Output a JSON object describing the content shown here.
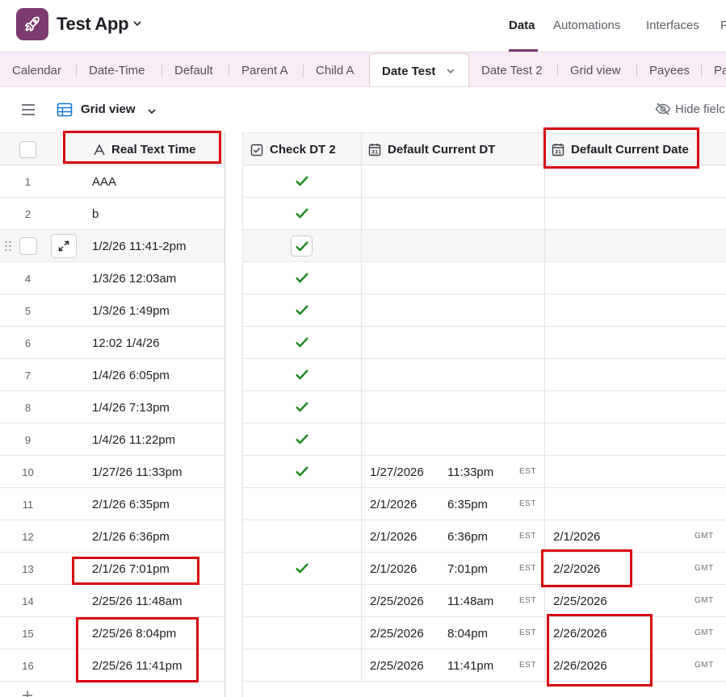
{
  "app": {
    "title": "Test App",
    "accent_color": "#7c3a6e",
    "icon": "rocket-icon"
  },
  "top_nav": [
    {
      "label": "Data",
      "active": true
    },
    {
      "label": "Automations",
      "active": false
    },
    {
      "label": "Interfaces",
      "active": false
    },
    {
      "label": "F",
      "active": false
    }
  ],
  "tabs": [
    {
      "label": "Calendar"
    },
    {
      "label": "Date-Time"
    },
    {
      "label": "Default"
    },
    {
      "label": "Parent A"
    },
    {
      "label": "Child A"
    },
    {
      "label": "Date Test",
      "active": true
    },
    {
      "label": "Date Test 2"
    },
    {
      "label": "Grid view"
    },
    {
      "label": "Payees"
    },
    {
      "label": "Pa"
    }
  ],
  "view": {
    "name": "Grid view",
    "hide_fields_label": "Hide fielc"
  },
  "columns": [
    {
      "label": "Real Text Time",
      "type": "text",
      "icon": "text-field-icon"
    },
    {
      "label": "Check DT 2",
      "type": "checkbox",
      "icon": "checkbox-field-icon"
    },
    {
      "label": "Default Current DT",
      "type": "datetime",
      "icon": "calendar-field-icon"
    },
    {
      "label": "Default Current Date",
      "type": "date",
      "icon": "calendar-field-icon"
    }
  ],
  "rows": [
    {
      "num": "1",
      "text": "AAA",
      "check": true,
      "dt_date": "",
      "dt_time": "",
      "dt_tz": "",
      "d_date": "",
      "d_tz": ""
    },
    {
      "num": "2",
      "text": "b",
      "check": true,
      "dt_date": "",
      "dt_time": "",
      "dt_tz": "",
      "d_date": "",
      "d_tz": ""
    },
    {
      "num": "3",
      "text": "1/2/26 11:41-2pm",
      "check": true,
      "dt_date": "",
      "dt_time": "",
      "dt_tz": "",
      "d_date": "",
      "d_tz": "",
      "hovered": true
    },
    {
      "num": "4",
      "text": "1/3/26 12:03am",
      "check": true,
      "dt_date": "",
      "dt_time": "",
      "dt_tz": "",
      "d_date": "",
      "d_tz": ""
    },
    {
      "num": "5",
      "text": "1/3/26 1:49pm",
      "check": true,
      "dt_date": "",
      "dt_time": "",
      "dt_tz": "",
      "d_date": "",
      "d_tz": ""
    },
    {
      "num": "6",
      "text": "12:02 1/4/26",
      "check": true,
      "dt_date": "",
      "dt_time": "",
      "dt_tz": "",
      "d_date": "",
      "d_tz": ""
    },
    {
      "num": "7",
      "text": "1/4/26 6:05pm",
      "check": true,
      "dt_date": "",
      "dt_time": "",
      "dt_tz": "",
      "d_date": "",
      "d_tz": ""
    },
    {
      "num": "8",
      "text": "1/4/26 7:13pm",
      "check": true,
      "dt_date": "",
      "dt_time": "",
      "dt_tz": "",
      "d_date": "",
      "d_tz": ""
    },
    {
      "num": "9",
      "text": "1/4/26 11:22pm",
      "check": true,
      "dt_date": "",
      "dt_time": "",
      "dt_tz": "",
      "d_date": "",
      "d_tz": ""
    },
    {
      "num": "10",
      "text": "1/27/26 11:33pm",
      "check": true,
      "dt_date": "1/27/2026",
      "dt_time": "11:33pm",
      "dt_tz": "EST",
      "d_date": "",
      "d_tz": ""
    },
    {
      "num": "11",
      "text": "2/1/26 6:35pm",
      "check": false,
      "dt_date": "2/1/2026",
      "dt_time": "6:35pm",
      "dt_tz": "EST",
      "d_date": "",
      "d_tz": ""
    },
    {
      "num": "12",
      "text": "2/1/26 6:36pm",
      "check": false,
      "dt_date": "2/1/2026",
      "dt_time": "6:36pm",
      "dt_tz": "EST",
      "d_date": "2/1/2026",
      "d_tz": "GMT"
    },
    {
      "num": "13",
      "text": "2/1/26 7:01pm",
      "check": true,
      "dt_date": "2/1/2026",
      "dt_time": "7:01pm",
      "dt_tz": "EST",
      "d_date": "2/2/2026",
      "d_tz": "GMT"
    },
    {
      "num": "14",
      "text": "2/25/26 11:48am",
      "check": false,
      "dt_date": "2/25/2026",
      "dt_time": "11:48am",
      "dt_tz": "EST",
      "d_date": "2/25/2026",
      "d_tz": "GMT"
    },
    {
      "num": "15",
      "text": "2/25/26 8:04pm",
      "check": false,
      "dt_date": "2/25/2026",
      "dt_time": "8:04pm",
      "dt_tz": "EST",
      "d_date": "2/26/2026",
      "d_tz": "GMT"
    },
    {
      "num": "16",
      "text": "2/25/26 11:41pm",
      "check": false,
      "dt_date": "2/25/2026",
      "dt_time": "11:41pm",
      "dt_tz": "EST",
      "d_date": "2/26/2026",
      "d_tz": "GMT"
    }
  ],
  "colors": {
    "checkmark": "#1a8a1a",
    "annotation": "#d9000e",
    "tabs_bg": "#f8ecf5"
  }
}
